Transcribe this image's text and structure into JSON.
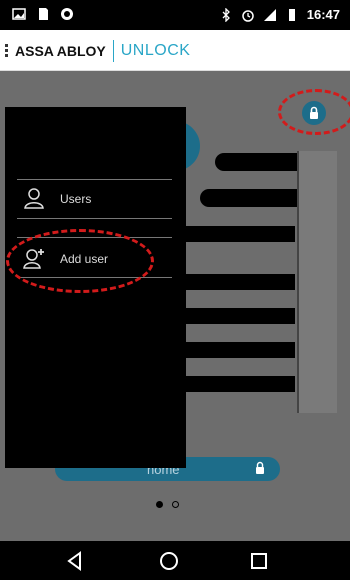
{
  "status_bar": {
    "time": "16:47",
    "left_icons": [
      "image-icon",
      "sd-card-icon",
      "app-icon"
    ],
    "right_icons": [
      "bluetooth-icon",
      "alarm-icon",
      "signal-icon",
      "battery-icon"
    ]
  },
  "header": {
    "brand": "ASSA ABLOY",
    "product": "UNLOCK"
  },
  "drawer": {
    "items": [
      {
        "label": "Users",
        "icon": "user-icon"
      },
      {
        "label": "Add user",
        "icon": "add-user-icon"
      }
    ]
  },
  "background": {
    "home_label": "home"
  },
  "nav": {
    "back": "back-icon",
    "home": "home-icon",
    "recents": "recents-icon"
  },
  "colors": {
    "accent": "#2aa6c7",
    "highlight": "#d21b1b",
    "fab": "#1d6d8a"
  }
}
